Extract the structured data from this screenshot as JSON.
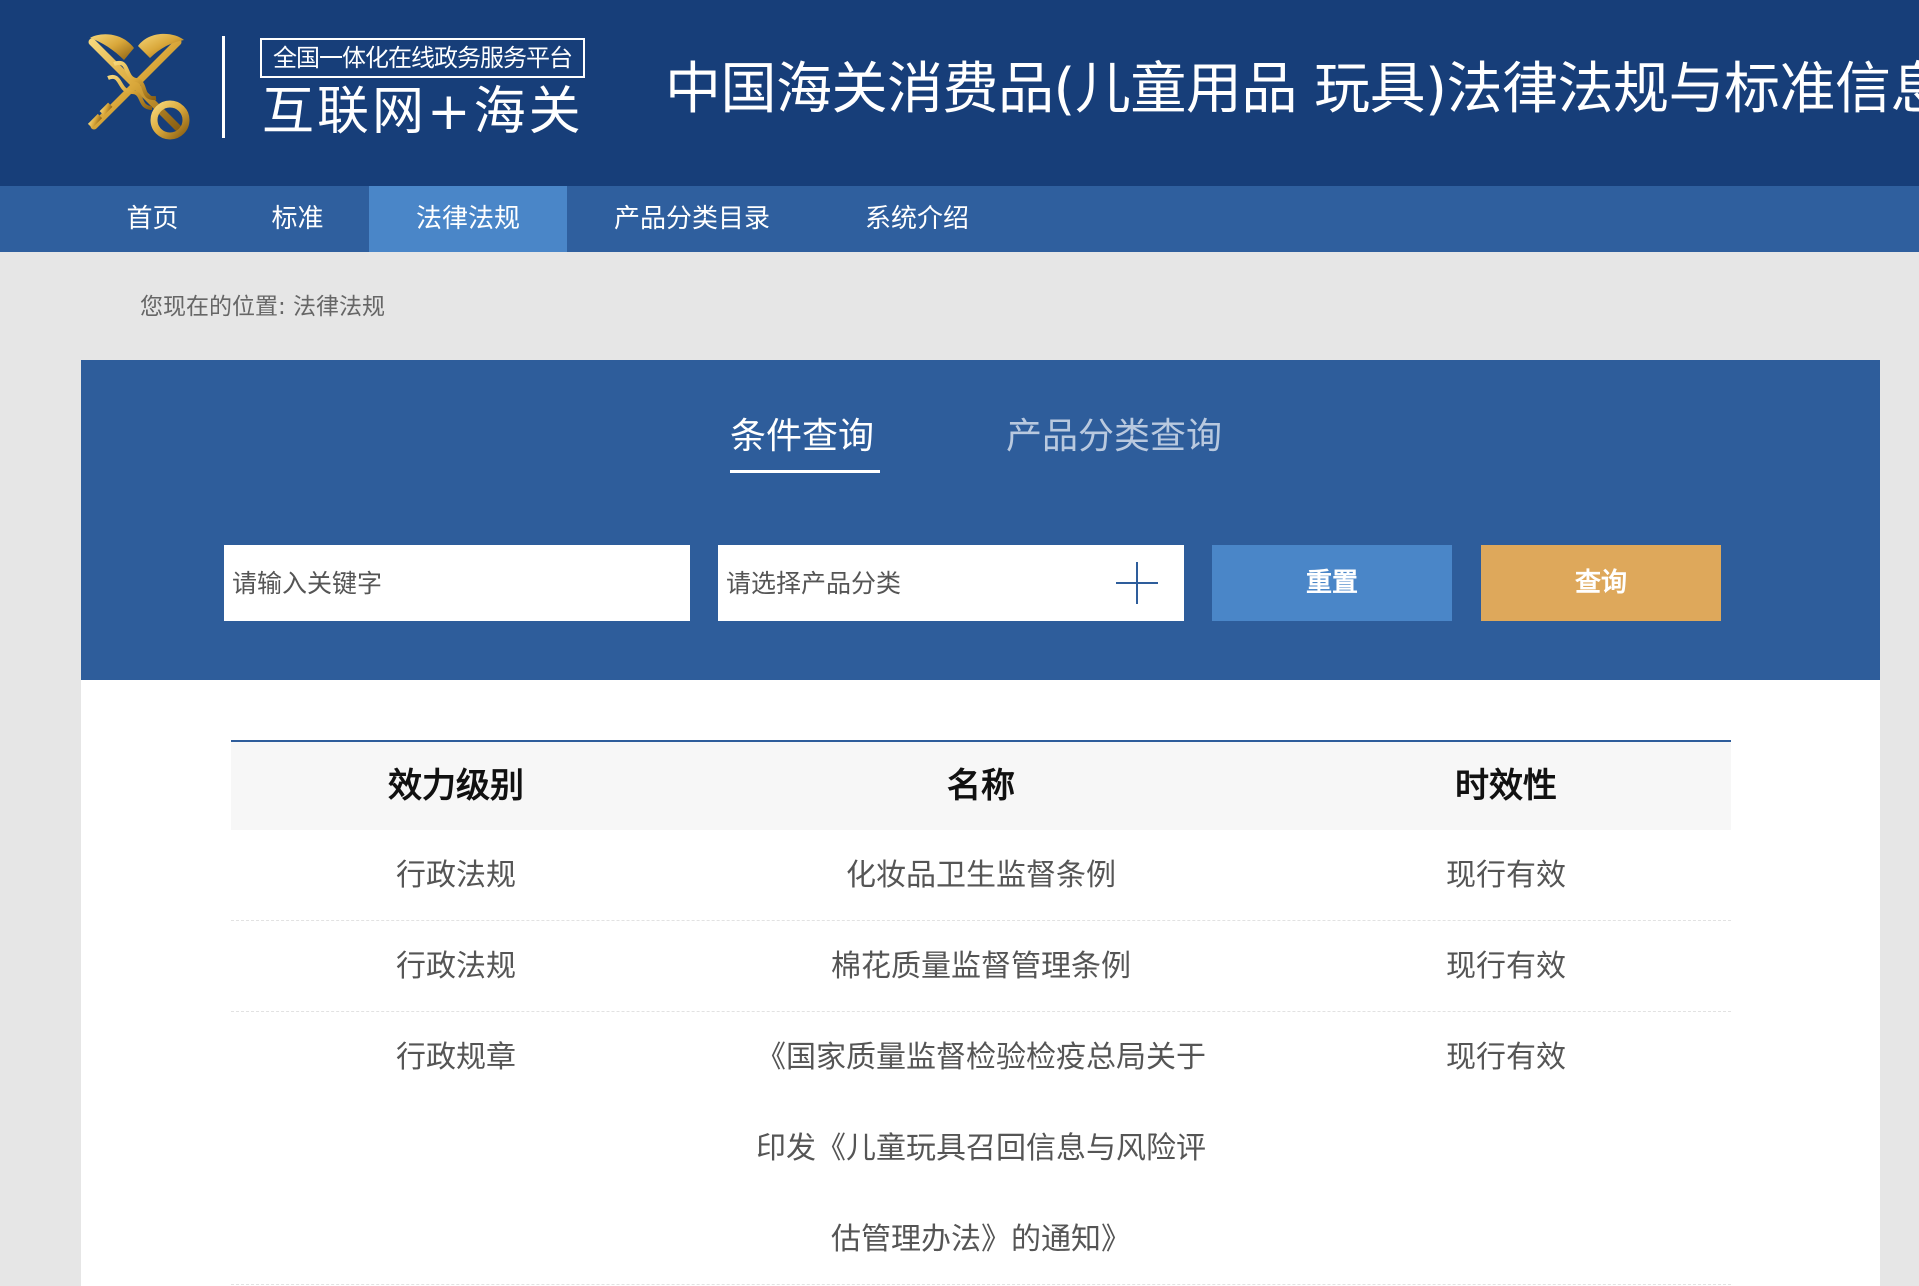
{
  "header": {
    "platform_line": "全国一体化在线政务服务平台",
    "platform_sub": "互联网+海关",
    "site_title": "中国海关消费品(儿童用品  玩具)法律法规与标准信息"
  },
  "nav": {
    "items": [
      {
        "label": "首页"
      },
      {
        "label": "标准"
      },
      {
        "label": "法律法规",
        "active": true
      },
      {
        "label": "产品分类目录"
      },
      {
        "label": "系统介绍"
      }
    ]
  },
  "breadcrumb": "您现在的位置: 法律法规",
  "search": {
    "tabs": [
      {
        "label": "条件查询",
        "active": true
      },
      {
        "label": "产品分类查询"
      }
    ],
    "keyword_placeholder": "请输入关键字",
    "category_placeholder": "请选择产品分类",
    "reset_label": "重置",
    "query_label": "查询"
  },
  "table": {
    "columns": [
      "效力级别",
      "名称",
      "时效性"
    ],
    "rows": [
      {
        "level": "行政法规",
        "name": "化妆品卫生监督条例",
        "status": "现行有效"
      },
      {
        "level": "行政法规",
        "name": "棉花质量监督管理条例",
        "status": "现行有效"
      },
      {
        "level": "行政规章",
        "name": "《国家质量监督检验检疫总局关于印发《儿童玩具召回信息与风险评估管理办法》的通知》",
        "status": "现行有效"
      }
    ]
  },
  "colors": {
    "header_bg": "#173e79",
    "nav_bg": "#2f5f9e",
    "nav_active": "#4a86c8",
    "panel_bg": "#2e5d9b",
    "query_button": "#dea85b"
  }
}
